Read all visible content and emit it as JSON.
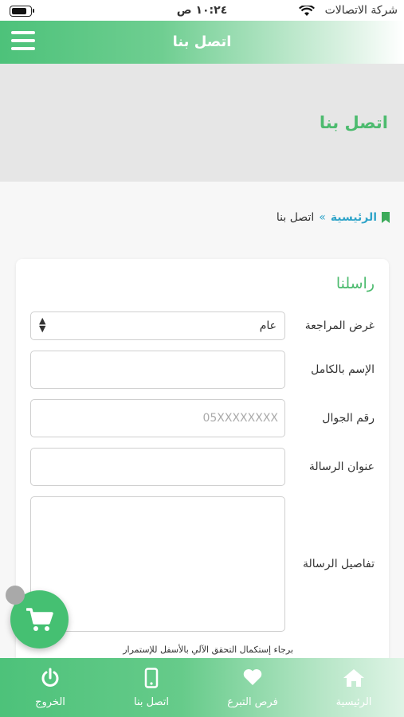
{
  "status_bar": {
    "time": "١٠:٢٤ ص",
    "carrier": "شركة الاتصالات"
  },
  "header": {
    "title": "اتصل بنا",
    "menu_icon": "hamburger-menu-icon"
  },
  "banner": {
    "title": "اتصل بنا"
  },
  "breadcrumb": {
    "home": "الرئيسية",
    "separator": "»",
    "current": "اتصل بنا",
    "icon": "bookmark-icon"
  },
  "form": {
    "title": "راسلنا",
    "purpose_label": "غرض المراجعة",
    "purpose_value": "عام",
    "full_name_label": "الإسم بالكامل",
    "full_name_value": "",
    "mobile_label": "رقم الجوال",
    "mobile_placeholder": "05XXXXXXXX",
    "subject_label": "عنوان الرسالة",
    "subject_value": "",
    "details_label": "تفاصيل الرسالة",
    "details_value": "",
    "captcha_note": "برجاء إستكمال التحقق الآلي بالأسفل للإستمرار"
  },
  "floating_button": {
    "icon": "shopping-cart-icon"
  },
  "bottom_nav": {
    "items": [
      {
        "label": "الرئيسية",
        "icon": "home-icon"
      },
      {
        "label": "فرص التبرع",
        "icon": "heart-icon"
      },
      {
        "label": "اتصل بنا",
        "icon": "mobile-phone-icon"
      },
      {
        "label": "الخروج",
        "icon": "power-icon"
      }
    ]
  },
  "colors": {
    "brand_green": "#4dc27a",
    "title_green": "#4dbb6f",
    "link_blue": "#2fa4c9"
  }
}
